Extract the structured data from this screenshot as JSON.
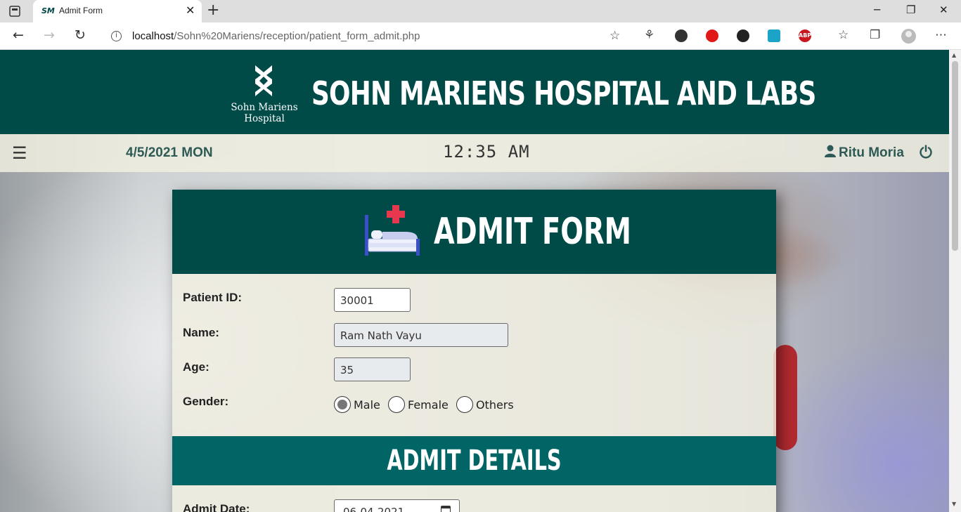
{
  "browser": {
    "tab_favicon": "SM",
    "tab_title": "Admit Form",
    "tab_close": "✕",
    "new_tab": "+",
    "url_host": "localhost",
    "url_path": "/Sohn%20Mariens/reception/patient_form_admit.php",
    "window_controls": [
      "─",
      "❐",
      "✕"
    ],
    "extensions": [
      "ABP"
    ]
  },
  "site": {
    "logo_line1": "Sohn Mariens",
    "logo_line2": "Hospital",
    "title": "SOHN MARIENS HOSPITAL AND LABS"
  },
  "info_bar": {
    "menu_icon": "☰",
    "date": "4/5/2021 MON",
    "time": "12:35 AM",
    "user": "Ritu Moria"
  },
  "form": {
    "title": "ADMIT FORM",
    "patient_id_label": "Patient ID:",
    "patient_id_value": "30001",
    "name_label": "Name:",
    "name_value": "Ram Nath Vayu",
    "age_label": "Age:",
    "age_value": "35",
    "gender_label": "Gender:",
    "gender_options": [
      "Male",
      "Female",
      "Others"
    ],
    "gender_selected": "Male",
    "admit_section_title": "ADMIT DETAILS",
    "admit_date_label": "Admit Date:",
    "admit_date_value": "06-04-2021"
  },
  "colors": {
    "header_bg": "#004a48",
    "section_bg": "#006564",
    "accent_red": "#e8384f"
  }
}
